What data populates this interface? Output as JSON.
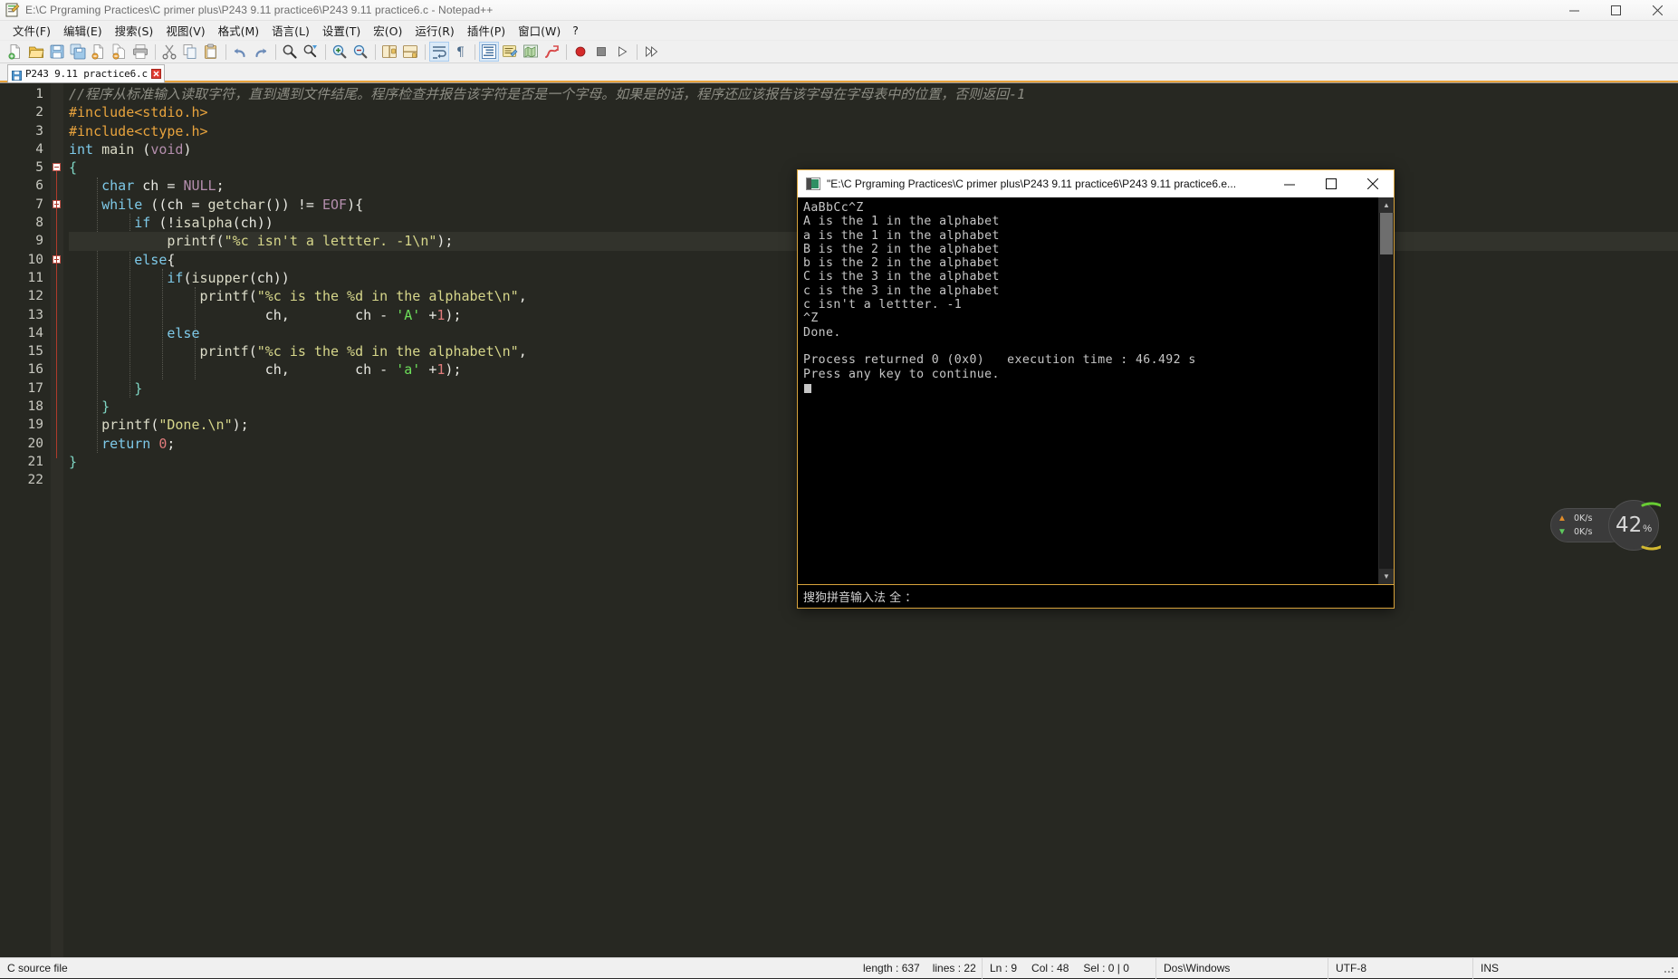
{
  "npp": {
    "title": "E:\\C Prgraming Practices\\C primer plus\\P243 9.11 practice6\\P243 9.11 practice6.c - Notepad++",
    "app_icon": "notepad-plus-plus-icon",
    "window_controls": {
      "minimize": "minimize-icon",
      "maximize": "maximize-icon",
      "close": "close-icon"
    },
    "menu": [
      {
        "label": "文件(F)",
        "name": "menu-file"
      },
      {
        "label": "编辑(E)",
        "name": "menu-edit"
      },
      {
        "label": "搜索(S)",
        "name": "menu-search"
      },
      {
        "label": "视图(V)",
        "name": "menu-view"
      },
      {
        "label": "格式(M)",
        "name": "menu-format"
      },
      {
        "label": "语言(L)",
        "name": "menu-language"
      },
      {
        "label": "设置(T)",
        "name": "menu-settings"
      },
      {
        "label": "宏(O)",
        "name": "menu-macro"
      },
      {
        "label": "运行(R)",
        "name": "menu-run"
      },
      {
        "label": "插件(P)",
        "name": "menu-plugins"
      },
      {
        "label": "窗口(W)",
        "name": "menu-window"
      },
      {
        "label": "?",
        "name": "menu-help"
      }
    ],
    "toolbar": [
      {
        "name": "new-file-icon",
        "glyph": "new"
      },
      {
        "name": "open-file-icon",
        "glyph": "open"
      },
      {
        "name": "save-icon",
        "glyph": "save"
      },
      {
        "name": "save-all-icon",
        "glyph": "saveall"
      },
      {
        "name": "close-file-icon",
        "glyph": "closefile"
      },
      {
        "name": "close-all-icon",
        "glyph": "closeall"
      },
      {
        "name": "print-icon",
        "glyph": "print"
      },
      {
        "name": "separator",
        "glyph": "sep"
      },
      {
        "name": "cut-icon",
        "glyph": "cut"
      },
      {
        "name": "copy-icon",
        "glyph": "copy"
      },
      {
        "name": "paste-icon",
        "glyph": "paste"
      },
      {
        "name": "separator",
        "glyph": "sep"
      },
      {
        "name": "undo-icon",
        "glyph": "undo"
      },
      {
        "name": "redo-icon",
        "glyph": "redo"
      },
      {
        "name": "separator",
        "glyph": "sep"
      },
      {
        "name": "find-icon",
        "glyph": "find"
      },
      {
        "name": "replace-icon",
        "glyph": "replace"
      },
      {
        "name": "separator",
        "glyph": "sep"
      },
      {
        "name": "zoom-in-icon",
        "glyph": "zoomin"
      },
      {
        "name": "zoom-out-icon",
        "glyph": "zoomout"
      },
      {
        "name": "separator",
        "glyph": "sep"
      },
      {
        "name": "sync-vertical-icon",
        "glyph": "syncv"
      },
      {
        "name": "sync-horizontal-icon",
        "glyph": "synch"
      },
      {
        "name": "separator",
        "glyph": "sep"
      },
      {
        "name": "word-wrap-icon",
        "glyph": "wrap",
        "active": true
      },
      {
        "name": "show-all-chars-icon",
        "glyph": "pilcrow"
      },
      {
        "name": "separator",
        "glyph": "sep"
      },
      {
        "name": "indent-guide-icon",
        "glyph": "indentguide",
        "active": true
      },
      {
        "name": "user-defined-dialog-icon",
        "glyph": "udl"
      },
      {
        "name": "document-map-icon",
        "glyph": "docmap"
      },
      {
        "name": "function-list-icon",
        "glyph": "funclist"
      },
      {
        "name": "separator",
        "glyph": "sep"
      },
      {
        "name": "record-macro-icon",
        "glyph": "record"
      },
      {
        "name": "stop-macro-icon",
        "glyph": "stop"
      },
      {
        "name": "play-macro-icon",
        "glyph": "play"
      },
      {
        "name": "separator",
        "glyph": "sep"
      },
      {
        "name": "run-macro-multiple-icon",
        "glyph": "runmulti"
      }
    ],
    "tab": {
      "label": "P243 9.11 practice6.c",
      "save_icon": "floppy-save-icon",
      "close_icon": "tab-close-icon"
    },
    "status": {
      "doc_type": "C source file",
      "length_label": "length : 637",
      "lines_label": "lines : 22",
      "ln_label": "Ln : 9",
      "col_label": "Col : 48",
      "sel_label": "Sel : 0 | 0",
      "eol": "Dos\\Windows",
      "encoding": "UTF-8",
      "insert_mode": "INS"
    }
  },
  "editor": {
    "line_numbers": [
      "1",
      "2",
      "3",
      "4",
      "5",
      "6",
      "7",
      "8",
      "9",
      "10",
      "11",
      "12",
      "13",
      "14",
      "15",
      "16",
      "17",
      "18",
      "19",
      "20",
      "21",
      "22"
    ],
    "current_line": 9,
    "lines": [
      {
        "n": 1,
        "tokens": [
          {
            "t": "//程序从标准输入读取字符，直到遇到文件结尾。程序检查并报告该字符是否是一个字母。如果是的话，程序还应该报告该字母在字母表中的位置，否则返回-1",
            "c": "t-comment"
          }
        ]
      },
      {
        "n": 2,
        "tokens": [
          {
            "t": "#include<stdio.h>",
            "c": "t-pre"
          }
        ]
      },
      {
        "n": 3,
        "tokens": [
          {
            "t": "#include<ctype.h>",
            "c": "t-pre"
          }
        ]
      },
      {
        "n": 4,
        "tokens": [
          {
            "t": "int",
            "c": "t-kw"
          },
          {
            "t": " ",
            "c": "t-plain"
          },
          {
            "t": "main",
            "c": "t-fn"
          },
          {
            "t": " (",
            "c": "t-plain"
          },
          {
            "t": "void",
            "c": "t-type"
          },
          {
            "t": ")",
            "c": "t-plain"
          }
        ]
      },
      {
        "n": 5,
        "tokens": [
          {
            "t": "{",
            "c": "t-brace"
          }
        ]
      },
      {
        "n": 6,
        "tokens": [
          {
            "t": "    ",
            "c": "t-plain"
          },
          {
            "t": "char",
            "c": "t-kw"
          },
          {
            "t": " ch = ",
            "c": "t-plain"
          },
          {
            "t": "NULL",
            "c": "t-type"
          },
          {
            "t": ";",
            "c": "t-plain"
          }
        ]
      },
      {
        "n": 7,
        "tokens": [
          {
            "t": "    ",
            "c": "t-plain"
          },
          {
            "t": "while",
            "c": "t-kw"
          },
          {
            "t": " ((ch = ",
            "c": "t-plain"
          },
          {
            "t": "getchar",
            "c": "t-fn"
          },
          {
            "t": "()) != ",
            "c": "t-plain"
          },
          {
            "t": "EOF",
            "c": "t-type"
          },
          {
            "t": "){",
            "c": "t-plain"
          }
        ]
      },
      {
        "n": 8,
        "tokens": [
          {
            "t": "        ",
            "c": "t-plain"
          },
          {
            "t": "if",
            "c": "t-kw"
          },
          {
            "t": " (!",
            "c": "t-plain"
          },
          {
            "t": "isalpha",
            "c": "t-fn"
          },
          {
            "t": "(ch))",
            "c": "t-plain"
          }
        ]
      },
      {
        "n": 9,
        "tokens": [
          {
            "t": "            ",
            "c": "t-plain"
          },
          {
            "t": "printf",
            "c": "t-fn"
          },
          {
            "t": "(",
            "c": "t-plain"
          },
          {
            "t": "\"%c isn't a lettter. -1\\n\"",
            "c": "t-str"
          },
          {
            "t": ");",
            "c": "t-plain"
          }
        ]
      },
      {
        "n": 10,
        "tokens": [
          {
            "t": "        ",
            "c": "t-plain"
          },
          {
            "t": "else",
            "c": "t-kw"
          },
          {
            "t": "{",
            "c": "t-plain"
          }
        ]
      },
      {
        "n": 11,
        "tokens": [
          {
            "t": "            ",
            "c": "t-plain"
          },
          {
            "t": "if",
            "c": "t-kw"
          },
          {
            "t": "(",
            "c": "t-plain"
          },
          {
            "t": "isupper",
            "c": "t-fn"
          },
          {
            "t": "(ch))",
            "c": "t-plain"
          }
        ]
      },
      {
        "n": 12,
        "tokens": [
          {
            "t": "                ",
            "c": "t-plain"
          },
          {
            "t": "printf",
            "c": "t-fn"
          },
          {
            "t": "(",
            "c": "t-plain"
          },
          {
            "t": "\"%c is the %d in the alphabet\\n\"",
            "c": "t-str"
          },
          {
            "t": ",",
            "c": "t-plain"
          }
        ]
      },
      {
        "n": 13,
        "tokens": [
          {
            "t": "                        ch,        ch - ",
            "c": "t-plain"
          },
          {
            "t": "'A'",
            "c": "t-chr"
          },
          {
            "t": " +",
            "c": "t-plain"
          },
          {
            "t": "1",
            "c": "t-num"
          },
          {
            "t": ");",
            "c": "t-plain"
          }
        ]
      },
      {
        "n": 14,
        "tokens": [
          {
            "t": "            ",
            "c": "t-plain"
          },
          {
            "t": "else",
            "c": "t-kw"
          }
        ]
      },
      {
        "n": 15,
        "tokens": [
          {
            "t": "                ",
            "c": "t-plain"
          },
          {
            "t": "printf",
            "c": "t-fn"
          },
          {
            "t": "(",
            "c": "t-plain"
          },
          {
            "t": "\"%c is the %d in the alphabet\\n\"",
            "c": "t-str"
          },
          {
            "t": ",",
            "c": "t-plain"
          }
        ]
      },
      {
        "n": 16,
        "tokens": [
          {
            "t": "                        ch,        ch - ",
            "c": "t-plain"
          },
          {
            "t": "'a'",
            "c": "t-chr"
          },
          {
            "t": " +",
            "c": "t-plain"
          },
          {
            "t": "1",
            "c": "t-num"
          },
          {
            "t": ");",
            "c": "t-plain"
          }
        ]
      },
      {
        "n": 17,
        "tokens": [
          {
            "t": "        }",
            "c": "t-brace"
          }
        ]
      },
      {
        "n": 18,
        "tokens": [
          {
            "t": "    }",
            "c": "t-brace"
          }
        ]
      },
      {
        "n": 19,
        "tokens": [
          {
            "t": "    ",
            "c": "t-plain"
          },
          {
            "t": "printf",
            "c": "t-fn"
          },
          {
            "t": "(",
            "c": "t-plain"
          },
          {
            "t": "\"Done.\\n\"",
            "c": "t-str"
          },
          {
            "t": ");",
            "c": "t-plain"
          }
        ]
      },
      {
        "n": 20,
        "tokens": [
          {
            "t": "    ",
            "c": "t-plain"
          },
          {
            "t": "return",
            "c": "t-kw"
          },
          {
            "t": " ",
            "c": "t-plain"
          },
          {
            "t": "0",
            "c": "t-num"
          },
          {
            "t": ";",
            "c": "t-plain"
          }
        ]
      },
      {
        "n": 21,
        "tokens": [
          {
            "t": "}",
            "c": "t-brace"
          }
        ]
      },
      {
        "n": 22,
        "tokens": []
      }
    ],
    "fold_markers": [
      {
        "line": 5,
        "type": "box"
      },
      {
        "line": 7,
        "type": "box"
      },
      {
        "line": 10,
        "type": "box"
      }
    ]
  },
  "console": {
    "icon": "console-app-icon",
    "title": "\"E:\\C Prgraming Practices\\C primer plus\\P243 9.11 practice6\\P243 9.11 practice6.e...",
    "window_controls": {
      "minimize": "minimize-icon",
      "maximize": "maximize-icon",
      "close": "close-icon"
    },
    "output": [
      "AaBbCc^Z",
      "A is the 1 in the alphabet",
      "a is the 1 in the alphabet",
      "B is the 2 in the alphabet",
      "b is the 2 in the alphabet",
      "C is the 3 in the alphabet",
      "c is the 3 in the alphabet",
      "c isn't a lettter. -1",
      "^Z",
      "Done.",
      "",
      "Process returned 0 (0x0)   execution time : 46.492 s",
      "Press any key to continue."
    ],
    "ime_status": "搜狗拼音输入法 全 ：",
    "scrollbar": {
      "up_arrow": "scroll-up-icon",
      "down_arrow": "scroll-down-icon"
    }
  },
  "net_widget": {
    "upload": "0K/s",
    "download": "0K/s",
    "percent_value": "42",
    "percent_symbol": "%",
    "upload_arrow_color": "#e08c2a",
    "download_arrow_color": "#5ec95e",
    "gauge_start_color": "#66cc33",
    "gauge_end_color": "#d4b830"
  }
}
